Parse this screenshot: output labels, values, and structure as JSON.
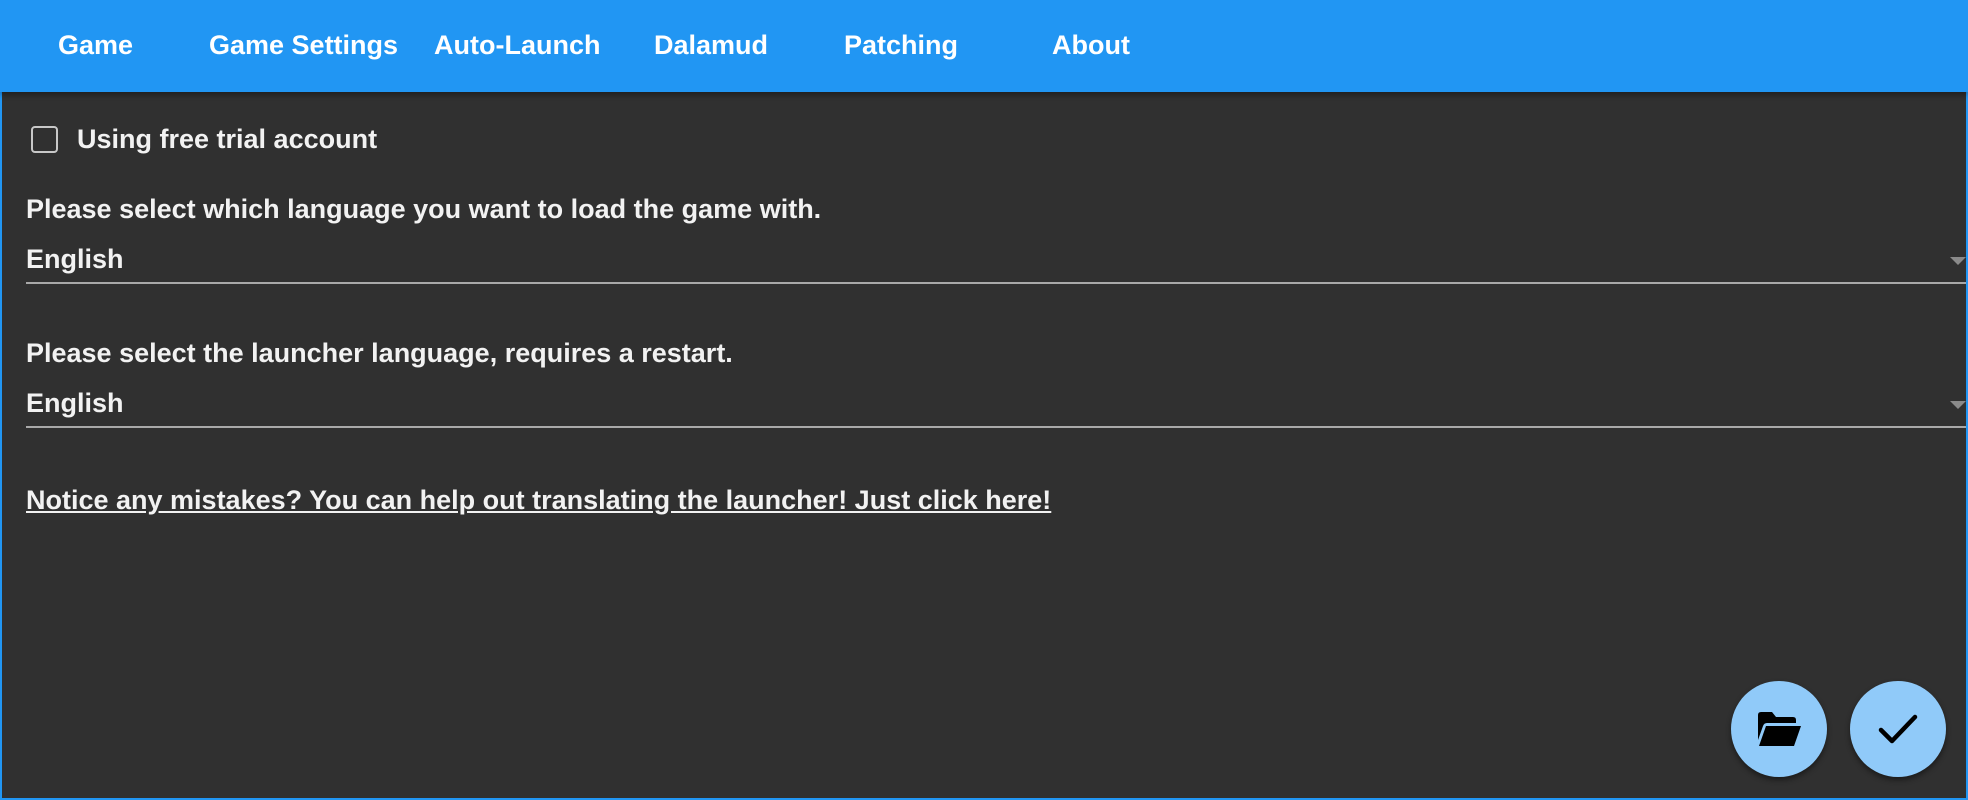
{
  "tabs": [
    {
      "label": "Game"
    },
    {
      "label": "Game Settings"
    },
    {
      "label": "Auto-Launch"
    },
    {
      "label": "Dalamud"
    },
    {
      "label": "Patching"
    },
    {
      "label": "About"
    }
  ],
  "settings": {
    "free_trial_label": "Using free trial account",
    "free_trial_checked": false,
    "game_language_prompt": "Please select which language you want to load the game with.",
    "game_language_value": "English",
    "launcher_language_prompt": "Please select the launcher language, requires a restart.",
    "launcher_language_value": "English",
    "translate_link": "Notice any mistakes? You can help out translating the launcher! Just click here!"
  },
  "actions": {
    "open_folder_icon": "folder-open-icon",
    "accept_icon": "check-icon"
  },
  "colors": {
    "accent": "#2196F3",
    "background": "#303030",
    "fab": "#90CAF9",
    "text": "#F2F2F2"
  }
}
